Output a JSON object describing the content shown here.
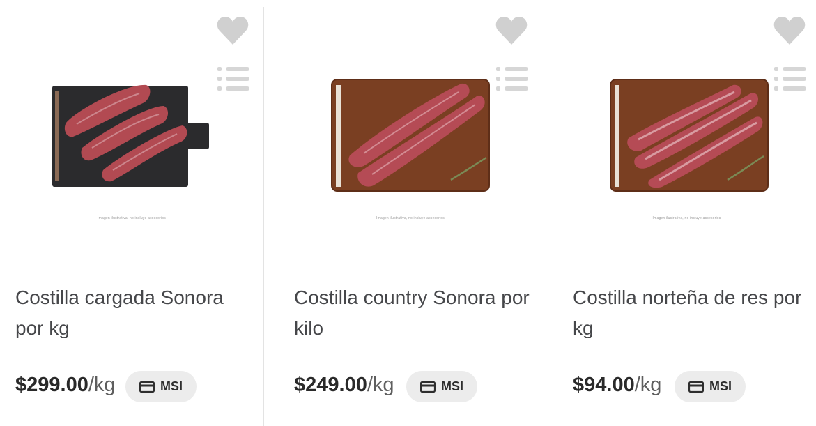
{
  "colors": {
    "icon_gray": "#d0d0d0",
    "text_dark": "#46474a",
    "badge_bg": "#ececec",
    "board_dark": "#2b2b2d",
    "board_wood": "#7a3f22",
    "meat": "#b24a52"
  },
  "products": [
    {
      "name": "Costilla cargada Sonora por kg",
      "price": "$299.00",
      "unit": "/kg",
      "badge": "MSI",
      "board": "dark",
      "icons": [
        "heart-icon",
        "list-icon",
        "card-icon"
      ]
    },
    {
      "name": "Costilla country Sonora por kilo",
      "price": "$249.00",
      "unit": "/kg",
      "badge": "MSI",
      "board": "wood",
      "icons": [
        "heart-icon",
        "list-icon",
        "card-icon"
      ]
    },
    {
      "name": "Costilla norteña de res por kg",
      "price": "$94.00",
      "unit": "/kg",
      "badge": "MSI",
      "board": "wood",
      "icons": [
        "heart-icon",
        "list-icon",
        "card-icon"
      ]
    }
  ]
}
